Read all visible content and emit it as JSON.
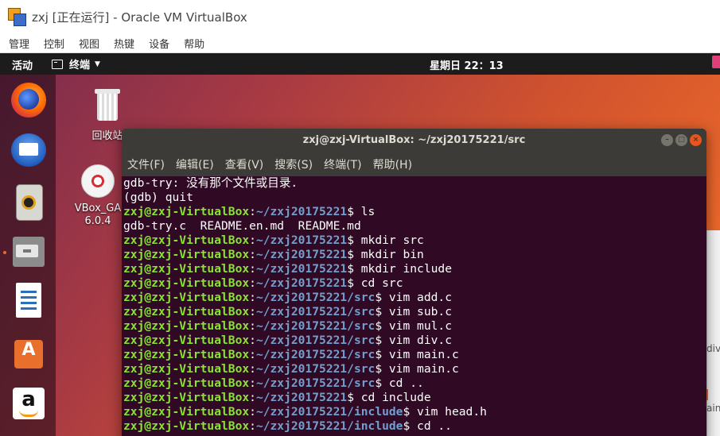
{
  "host": {
    "window_title": "zxj [正在运行] - Oracle VM VirtualBox",
    "menu": [
      "管理",
      "控制",
      "视图",
      "热键",
      "设备",
      "帮助"
    ]
  },
  "guest": {
    "topbar": {
      "activities": "活动",
      "app_menu": "终端",
      "clock": "星期日 22：13"
    },
    "dock": [
      "firefox-icon",
      "thunderbird-icon",
      "rhythmbox-icon",
      "files-icon",
      "libreoffice-writer-icon",
      "ubuntu-software-icon",
      "amazon-icon"
    ],
    "desktop_icons": {
      "trash_label": "回收站",
      "disc_label_line1": "VBox_GA",
      "disc_label_line2": "6.0.4"
    },
    "background_window": {
      "text1": "div.",
      "text2": "ain"
    }
  },
  "terminal": {
    "title": "zxj@zxj-VirtualBox: ~/zxj20175221/src",
    "menu": [
      "文件(F)",
      "编辑(E)",
      "查看(V)",
      "搜索(S)",
      "终端(T)",
      "帮助(H)"
    ],
    "lines": [
      {
        "text": "gdb-try: 没有那个文件或目录."
      },
      {
        "text": "(gdb) quit"
      },
      {
        "user": "zxj@zxj-VirtualBox",
        "path": "~/zxj20175221",
        "cmd": "$ ls"
      },
      {
        "text": "gdb-try.c  README.en.md  README.md"
      },
      {
        "user": "zxj@zxj-VirtualBox",
        "path": "~/zxj20175221",
        "cmd": "$ mkdir src"
      },
      {
        "user": "zxj@zxj-VirtualBox",
        "path": "~/zxj20175221",
        "cmd": "$ mkdir bin"
      },
      {
        "user": "zxj@zxj-VirtualBox",
        "path": "~/zxj20175221",
        "cmd": "$ mkdir include"
      },
      {
        "user": "zxj@zxj-VirtualBox",
        "path": "~/zxj20175221",
        "cmd": "$ cd src"
      },
      {
        "user": "zxj@zxj-VirtualBox",
        "path": "~/zxj20175221/src",
        "cmd": "$ vim add.c"
      },
      {
        "user": "zxj@zxj-VirtualBox",
        "path": "~/zxj20175221/src",
        "cmd": "$ vim sub.c"
      },
      {
        "user": "zxj@zxj-VirtualBox",
        "path": "~/zxj20175221/src",
        "cmd": "$ vim mul.c"
      },
      {
        "user": "zxj@zxj-VirtualBox",
        "path": "~/zxj20175221/src",
        "cmd": "$ vim div.c"
      },
      {
        "user": "zxj@zxj-VirtualBox",
        "path": "~/zxj20175221/src",
        "cmd": "$ vim main.c"
      },
      {
        "user": "zxj@zxj-VirtualBox",
        "path": "~/zxj20175221/src",
        "cmd": "$ vim main.c"
      },
      {
        "user": "zxj@zxj-VirtualBox",
        "path": "~/zxj20175221/src",
        "cmd": "$ cd .."
      },
      {
        "user": "zxj@zxj-VirtualBox",
        "path": "~/zxj20175221",
        "cmd": "$ cd include"
      },
      {
        "user": "zxj@zxj-VirtualBox",
        "path": "~/zxj20175221/include",
        "cmd": "$ vim head.h"
      },
      {
        "user": "zxj@zxj-VirtualBox",
        "path": "~/zxj20175221/include",
        "cmd": "$ cd .."
      }
    ]
  }
}
